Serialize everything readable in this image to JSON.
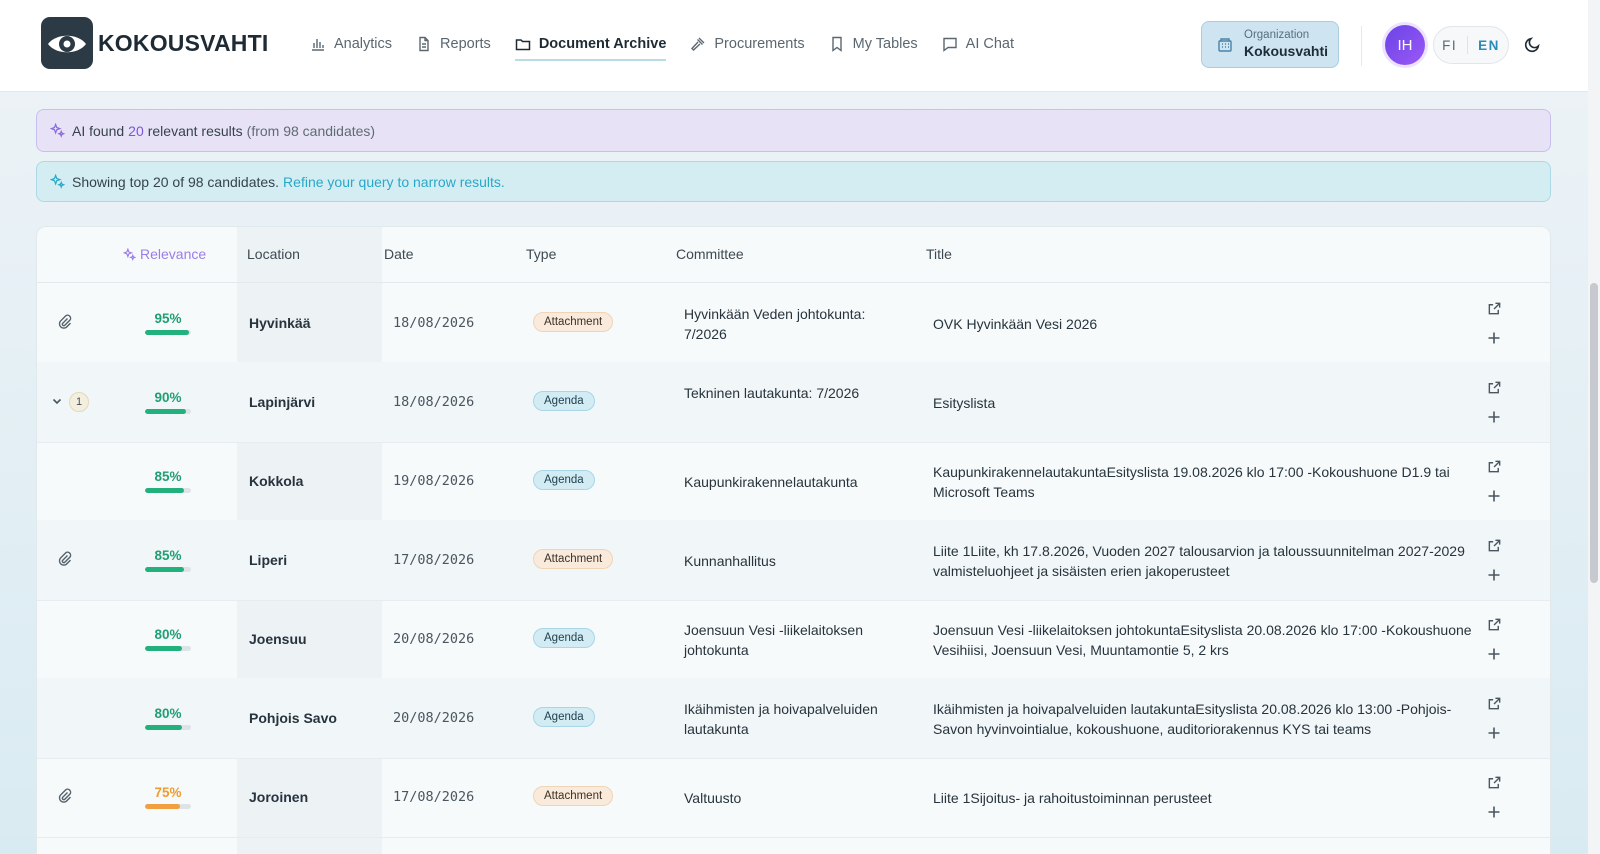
{
  "app": {
    "name": "KOKOUSVAHTI"
  },
  "nav": [
    {
      "label": "Analytics",
      "icon": "bar-chart-icon",
      "active": false
    },
    {
      "label": "Reports",
      "icon": "document-icon",
      "active": false
    },
    {
      "label": "Document Archive",
      "icon": "folder-icon",
      "active": true
    },
    {
      "label": "Procurements",
      "icon": "gavel-icon",
      "active": false
    },
    {
      "label": "My Tables",
      "icon": "bookmark-icon",
      "active": false
    },
    {
      "label": "AI Chat",
      "icon": "chat-icon",
      "active": false
    }
  ],
  "org": {
    "label": "Organization",
    "name": "Kokousvahti"
  },
  "user": {
    "initials": "IH"
  },
  "lang": {
    "fi": "FI",
    "en": "EN"
  },
  "banner_ai": {
    "prefix": "AI found",
    "count": "20",
    "suffix": "relevant results",
    "candidates": "(from 98 candidates)"
  },
  "banner_info": {
    "text": "Showing top 20 of 98 candidates.",
    "link": "Refine your query to narrow results."
  },
  "table": {
    "headers": {
      "relevance": "Relevance",
      "location": "Location",
      "date": "Date",
      "type": "Type",
      "committee": "Committee",
      "title": "Title"
    },
    "rows": [
      {
        "lead": "attachment",
        "relevance": "95%",
        "relevance_value": 0.95,
        "location": "Hyvinkää",
        "date": "18/08/2026",
        "type": "Attachment",
        "committee": "Hyvinkään Veden johtokunta: 7/2026",
        "title": "OVK Hyvinkään Vesi 2026"
      },
      {
        "lead": "expand",
        "count": "1",
        "relevance": "90%",
        "relevance_value": 0.9,
        "location": "Lapinjärvi",
        "date": "18/08/2026",
        "type": "Agenda",
        "committee": "Tekninen lautakunta: 7/2026",
        "title": "Esityslista"
      },
      {
        "lead": "none",
        "relevance": "85%",
        "relevance_value": 0.85,
        "location": "Kokkola",
        "date": "19/08/2026",
        "type": "Agenda",
        "committee": "Kaupunkirakennelautakunta",
        "title": "KaupunkirakennelautakuntaEsityslista 19.08.2026 klo 17:00 -Kokoushuone D1.9 tai Microsoft Teams"
      },
      {
        "lead": "attachment",
        "relevance": "85%",
        "relevance_value": 0.85,
        "location": "Liperi",
        "date": "17/08/2026",
        "type": "Attachment",
        "committee": "Kunnanhallitus",
        "title": "Liite 1Liite, kh 17.8.2026, Vuoden 2027 talousarvion ja taloussuunnitelman 2027-2029 valmisteluohjeet ja sisäisten erien jakoperusteet"
      },
      {
        "lead": "none",
        "relevance": "80%",
        "relevance_value": 0.8,
        "location": "Joensuu",
        "date": "20/08/2026",
        "type": "Agenda",
        "committee": "Joensuun Vesi -liikelaitoksen johtokunta",
        "title": "Joensuun Vesi -liikelaitoksen johtokuntaEsityslista 20.08.2026 klo 17:00 -Kokoushuone Vesihiisi, Joensuun Vesi, Muuntamontie 5, 2 krs"
      },
      {
        "lead": "none",
        "relevance": "80%",
        "relevance_value": 0.8,
        "location": "Pohjois Savo",
        "date": "20/08/2026",
        "type": "Agenda",
        "committee": "Ikäihmisten ja hoivapalveluiden lautakunta",
        "title": "Ikäihmisten ja hoivapalveluiden lautakuntaEsityslista 20.08.2026 klo 13:00 -Pohjois-Savon hyvinvointialue, kokoushuone, auditoriorakennus KYS tai teams"
      },
      {
        "lead": "attachment",
        "relevance": "75%",
        "relevance_value": 0.75,
        "location": "Joroinen",
        "date": "17/08/2026",
        "type": "Attachment",
        "committee": "Valtuusto",
        "title": "Liite 1Sijoitus- ja rahoitustoiminnan perusteet"
      }
    ]
  },
  "colors": {
    "high": "#22b07d",
    "mid": "#f0a040",
    "high_text": "#1f9f72",
    "mid_text": "#ef9b2f"
  }
}
